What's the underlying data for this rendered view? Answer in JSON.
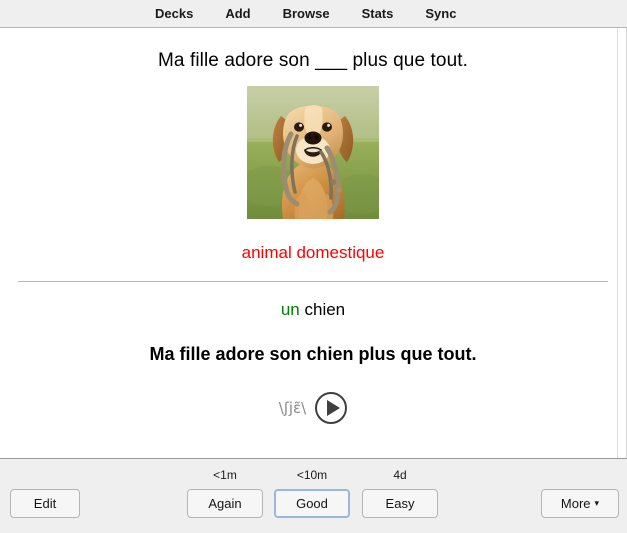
{
  "topbar": {
    "items": [
      {
        "label": "Decks",
        "name": "decks"
      },
      {
        "label": "Add",
        "name": "add"
      },
      {
        "label": "Browse",
        "name": "browse"
      },
      {
        "label": "Stats",
        "name": "stats"
      },
      {
        "label": "Sync",
        "name": "sync"
      }
    ]
  },
  "card": {
    "question": "Ma fille adore son ___ plus que tout.",
    "image_alt": "golden retriever dog holding a leash in its mouth on grass",
    "hint": "animal domestique",
    "hint_color": "#ff0000",
    "answer_article": "un",
    "answer_article_color": "#008000",
    "answer_word": "chien",
    "sentence": "Ma fille adore son chien plus que tout.",
    "ipa": "\\ʃjɛ̃\\",
    "play_icon": "play-icon"
  },
  "bottombar": {
    "edit_label": "Edit",
    "more_label": "More",
    "more_caret": "▾",
    "grades": [
      {
        "interval": "<1m",
        "label": "Again",
        "focused": false
      },
      {
        "interval": "<10m",
        "label": "Good",
        "focused": true
      },
      {
        "interval": "4d",
        "label": "Easy",
        "focused": false
      }
    ]
  }
}
